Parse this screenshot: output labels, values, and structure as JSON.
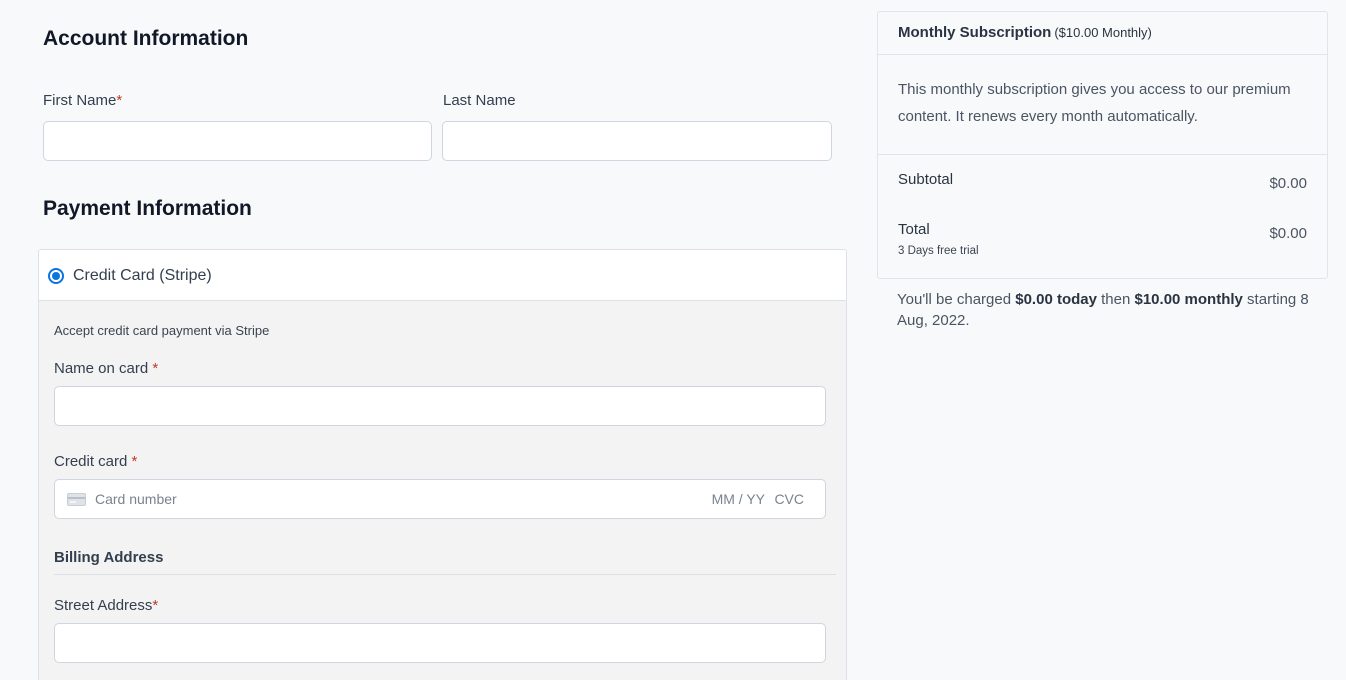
{
  "account": {
    "title": "Account Information",
    "first_name_label": "First Name",
    "last_name_label": "Last Name",
    "required_mark": "*",
    "first_name_value": "",
    "last_name_value": ""
  },
  "payment": {
    "title": "Payment Information",
    "method_label": "Credit Card (Stripe)",
    "method_selected": true,
    "description": "Accept credit card payment via Stripe",
    "name_on_card_label": "Name on card",
    "required_mark": " *",
    "name_on_card_value": "",
    "credit_card_label": "Credit card",
    "card_number_placeholder": "Card number",
    "expiry_placeholder": "MM / YY",
    "cvc_placeholder": "CVC",
    "billing_title": "Billing Address",
    "street_label": "Street Address",
    "street_required_mark": "*",
    "street_value": ""
  },
  "summary": {
    "title": "Monthly Subscription",
    "price_note": "($10.00 Monthly)",
    "description": "This monthly subscription gives you access to our premium content. It renews every month automatically.",
    "subtotal_label": "Subtotal",
    "subtotal_value": "$0.00",
    "total_label": "Total",
    "total_value": "$0.00",
    "trial_note": "3 Days free trial"
  },
  "charge_note": {
    "prefix": "You'll be charged ",
    "today_amount": "$0.00 today",
    "middle": " then ",
    "monthly_amount": "$10.00 monthly",
    "suffix": " starting 8 Aug, 2022."
  },
  "colors": {
    "accent": "#0b74de",
    "required": "#c0392b",
    "page_background": "#f8f9fb",
    "payment_panel_background": "#f3f3f3"
  }
}
